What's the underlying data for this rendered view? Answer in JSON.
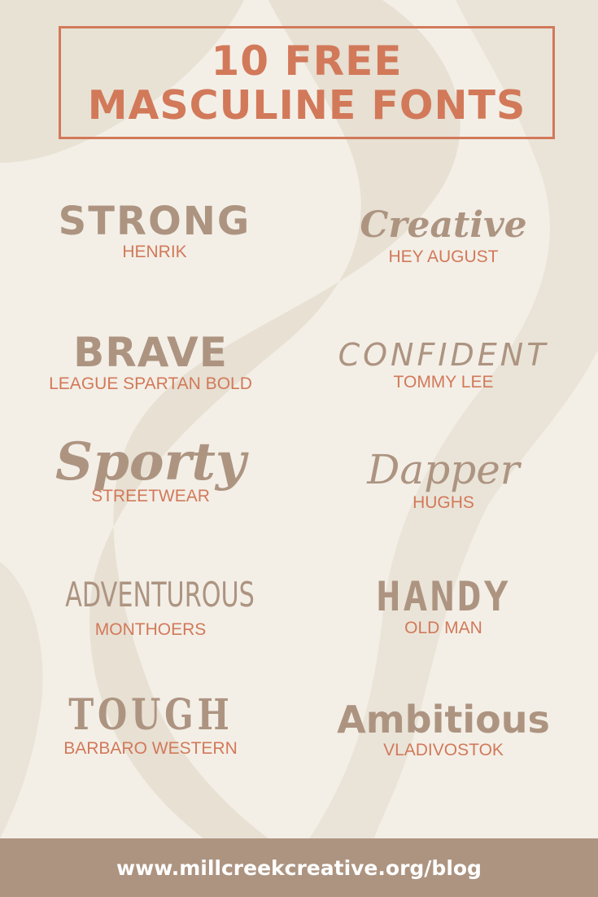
{
  "title": {
    "line1": "10 FREE",
    "line2": "MASCULINE FONTS"
  },
  "fonts": [
    {
      "sample": "STRONG",
      "name": "HENRIK"
    },
    {
      "sample": "Creative",
      "name": "HEY AUGUST"
    },
    {
      "sample": "BRAVE",
      "name": "LEAGUE SPARTAN BOLD"
    },
    {
      "sample": "CONFIDENT",
      "name": "TOMMY LEE"
    },
    {
      "sample": "Sporty",
      "name": "STREETWEAR"
    },
    {
      "sample": "Dapper",
      "name": "HUGHS"
    },
    {
      "sample": "ADVENTUROUS",
      "name": "MONTHOERS"
    },
    {
      "sample": "HANDY",
      "name": "OLD MAN"
    },
    {
      "sample": "TOUGH",
      "name": "BARBARO WESTERN"
    },
    {
      "sample": "Ambitious",
      "name": "VLADIVOSTOK"
    }
  ],
  "footer": {
    "url": "www.millcreekcreative.org/blog"
  },
  "colors": {
    "background": "#f3efe7",
    "wave": "#e7e0d3",
    "accent": "#d2795a",
    "taupe": "#ad9481",
    "footer_text": "#ffffff"
  }
}
